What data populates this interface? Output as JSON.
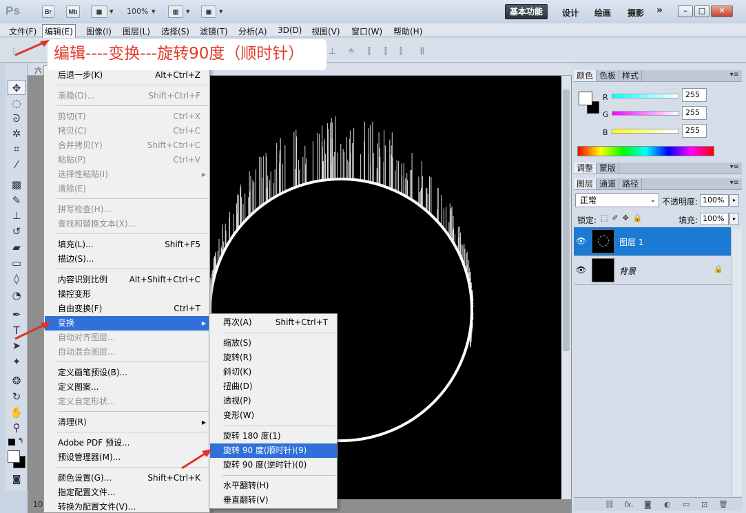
{
  "titlebar": {
    "app_logo": "Ps",
    "btn_bridge": "Br",
    "btn_minibridge": "Mb",
    "zoom": "100%",
    "workspaces": [
      "基本功能",
      "设计",
      "绘画",
      "摄影"
    ],
    "more": "»",
    "win_controls": [
      "–",
      "□",
      "✕"
    ]
  },
  "menubar": {
    "items": [
      "文件(F)",
      "编辑(E)",
      "图像(I)",
      "图层(L)",
      "选择(S)",
      "滤镜(T)",
      "分析(A)",
      "3D(D)",
      "视图(V)",
      "窗口(W)",
      "帮助(H)"
    ]
  },
  "annotation": "编辑----变换---旋转90度（顺时针）",
  "edit_menu": {
    "items": [
      {
        "label": "后退一步(K)",
        "shortcut": "Alt+Ctrl+Z",
        "enabled": true
      },
      {
        "label": "渐隐(D)...",
        "shortcut": "Shift+Ctrl+F",
        "enabled": false
      },
      {
        "label": "剪切(T)",
        "shortcut": "Ctrl+X",
        "enabled": false
      },
      {
        "label": "拷贝(C)",
        "shortcut": "Ctrl+C",
        "enabled": false
      },
      {
        "label": "合并拷贝(Y)",
        "shortcut": "Shift+Ctrl+C",
        "enabled": false
      },
      {
        "label": "粘贴(P)",
        "shortcut": "Ctrl+V",
        "enabled": false
      },
      {
        "label": "选择性粘贴(I)",
        "shortcut": "",
        "enabled": false,
        "submenu": true
      },
      {
        "label": "清除(E)",
        "shortcut": "",
        "enabled": false
      },
      {
        "label": "拼写检查(H)...",
        "shortcut": "",
        "enabled": false
      },
      {
        "label": "查找和替换文本(X)...",
        "shortcut": "",
        "enabled": false
      },
      {
        "label": "填充(L)...",
        "shortcut": "Shift+F5",
        "enabled": true
      },
      {
        "label": "描边(S)...",
        "shortcut": "",
        "enabled": true
      },
      {
        "label": "内容识别比例",
        "shortcut": "Alt+Shift+Ctrl+C",
        "enabled": true
      },
      {
        "label": "操控变形",
        "shortcut": "",
        "enabled": true
      },
      {
        "label": "自由变换(F)",
        "shortcut": "Ctrl+T",
        "enabled": true
      },
      {
        "label": "变换",
        "shortcut": "",
        "enabled": true,
        "submenu": true,
        "highlighted": true
      },
      {
        "label": "自动对齐图层...",
        "shortcut": "",
        "enabled": false
      },
      {
        "label": "自动混合图层...",
        "shortcut": "",
        "enabled": false
      },
      {
        "label": "定义画笔预设(B)...",
        "shortcut": "",
        "enabled": true
      },
      {
        "label": "定义图案...",
        "shortcut": "",
        "enabled": true
      },
      {
        "label": "定义自定形状...",
        "shortcut": "",
        "enabled": false
      },
      {
        "label": "清理(R)",
        "shortcut": "",
        "enabled": true,
        "submenu": true
      },
      {
        "label": "Adobe PDF 预设...",
        "shortcut": "",
        "enabled": true
      },
      {
        "label": "预设管理器(M)...",
        "shortcut": "",
        "enabled": true
      },
      {
        "label": "颜色设置(G)...",
        "shortcut": "Shift+Ctrl+K",
        "enabled": true
      },
      {
        "label": "指定配置文件...",
        "shortcut": "",
        "enabled": true
      },
      {
        "label": "转换为配置文件(V)...",
        "shortcut": "",
        "enabled": true
      }
    ]
  },
  "transform_submenu": {
    "items": [
      {
        "label": "再次(A)",
        "shortcut": "Shift+Ctrl+T"
      },
      {
        "label": "缩放(S)",
        "shortcut": ""
      },
      {
        "label": "旋转(R)",
        "shortcut": ""
      },
      {
        "label": "斜切(K)",
        "shortcut": ""
      },
      {
        "label": "扭曲(D)",
        "shortcut": ""
      },
      {
        "label": "透视(P)",
        "shortcut": ""
      },
      {
        "label": "变形(W)",
        "shortcut": ""
      },
      {
        "label": "旋转 180 度(1)",
        "shortcut": ""
      },
      {
        "label": "旋转 90 度(顺时针)(9)",
        "shortcut": "",
        "highlighted": true
      },
      {
        "label": "旋转 90 度(逆时针)(0)",
        "shortcut": ""
      },
      {
        "label": "水平翻转(H)",
        "shortcut": ""
      },
      {
        "label": "垂直翻转(V)",
        "shortcut": ""
      }
    ]
  },
  "color_panel": {
    "tabs": [
      "颜色",
      "色板",
      "样式"
    ],
    "r_label": "R",
    "g_label": "G",
    "b_label": "B",
    "r": "255",
    "g": "255",
    "b": "255"
  },
  "adjust_panel": {
    "tabs": [
      "调整",
      "蒙版"
    ]
  },
  "layers_panel": {
    "tabs": [
      "图层",
      "通道",
      "路径"
    ],
    "blend_mode": "正常",
    "opacity_label": "不透明度:",
    "opacity": "100%",
    "lock_label": "锁定:",
    "fill_label": "填充:",
    "fill": "100%",
    "layers": [
      {
        "name": "图层 1",
        "selected": true
      },
      {
        "name": "背景",
        "selected": false,
        "locked": true
      }
    ]
  },
  "status": {
    "zoom": "10"
  },
  "colors": {
    "accent": "#3070d8",
    "annotation_text": "#e23a2b",
    "arrow": "#e0312a"
  }
}
